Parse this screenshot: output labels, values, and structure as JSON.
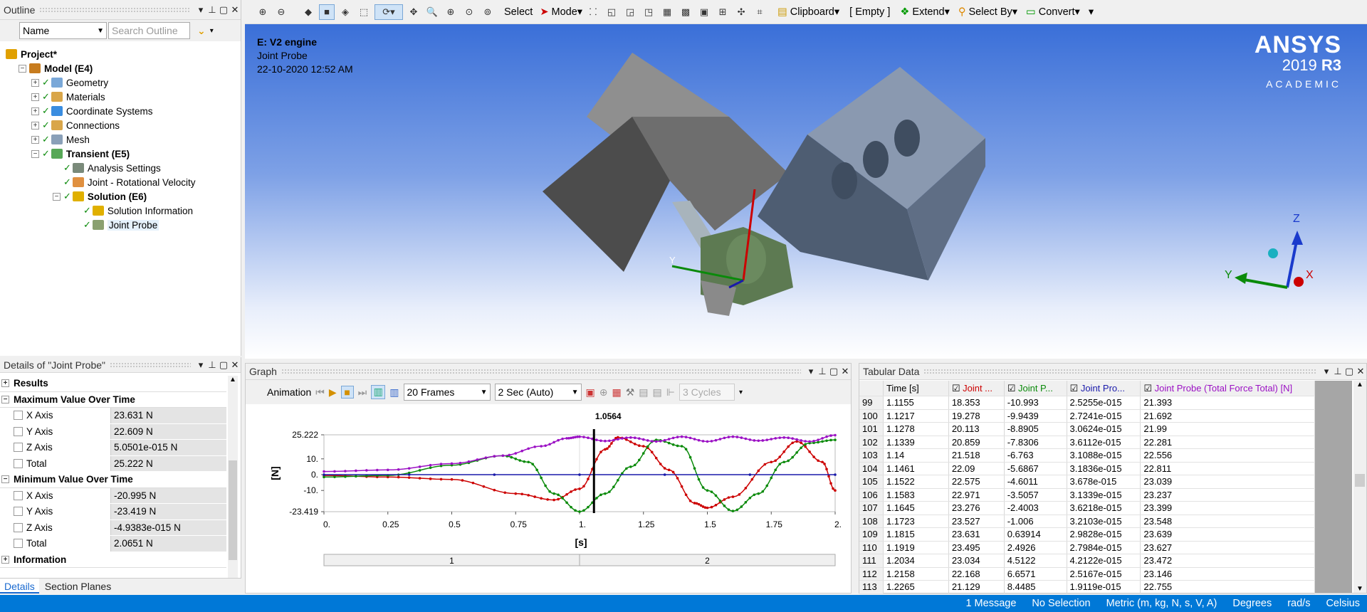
{
  "toolbar": {
    "select": "Select",
    "mode": "Mode",
    "clipboard": "Clipboard",
    "empty": "[ Empty ]",
    "extend": "Extend",
    "select_by": "Select By",
    "convert": "Convert"
  },
  "outline": {
    "title": "Outline",
    "filter_value": "Name",
    "search_placeholder": "Search Outline",
    "items": [
      {
        "label": "Project*",
        "level": 0,
        "bold": true,
        "icon": "project-icon"
      },
      {
        "label": "Model (E4)",
        "level": 1,
        "bold": true,
        "icon": "model-icon"
      },
      {
        "label": "Geometry",
        "level": 2,
        "bold": false,
        "icon": "geometry-icon"
      },
      {
        "label": "Materials",
        "level": 2,
        "bold": false,
        "icon": "materials-icon"
      },
      {
        "label": "Coordinate Systems",
        "level": 2,
        "bold": false,
        "icon": "coordinate-systems-icon"
      },
      {
        "label": "Connections",
        "level": 2,
        "bold": false,
        "icon": "connections-icon"
      },
      {
        "label": "Mesh",
        "level": 2,
        "bold": false,
        "icon": "mesh-icon"
      },
      {
        "label": "Transient (E5)",
        "level": 2,
        "bold": true,
        "icon": "transient-icon"
      },
      {
        "label": "Analysis Settings",
        "level": 3,
        "bold": false,
        "icon": "analysis-settings-icon"
      },
      {
        "label": "Joint - Rotational Velocity",
        "level": 3,
        "bold": false,
        "icon": "joint-load-icon"
      },
      {
        "label": "Solution (E6)",
        "level": 3,
        "bold": true,
        "icon": "solution-icon"
      },
      {
        "label": "Solution Information",
        "level": 4,
        "bold": false,
        "icon": "solution-information-icon"
      },
      {
        "label": "Joint Probe",
        "level": 4,
        "bold": false,
        "icon": "joint-probe-icon"
      }
    ]
  },
  "viewport": {
    "line1": "E: V2 engine",
    "line2": "Joint Probe",
    "line3": "22-10-2020 12:52 AM",
    "brand": "ANSYS",
    "version": "2019",
    "release": "R3",
    "edition": "ACADEMIC",
    "axis_z": "Z",
    "axis_y": "Y",
    "axis_x": "X"
  },
  "details": {
    "title": "Details of \"Joint Probe\"",
    "sections": [
      {
        "name": "Results",
        "expanded": false,
        "rows": []
      },
      {
        "name": "Maximum Value Over Time",
        "expanded": true,
        "rows": [
          {
            "label": "X Axis",
            "value": "23.631 N"
          },
          {
            "label": "Y Axis",
            "value": "22.609 N"
          },
          {
            "label": "Z Axis",
            "value": "5.0501e-015 N"
          },
          {
            "label": "Total",
            "value": "25.222 N"
          }
        ]
      },
      {
        "name": "Minimum Value Over Time",
        "expanded": true,
        "rows": [
          {
            "label": "X Axis",
            "value": "-20.995 N"
          },
          {
            "label": "Y Axis",
            "value": "-23.419 N"
          },
          {
            "label": "Z Axis",
            "value": "-4.9383e-015 N"
          },
          {
            "label": "Total",
            "value": "2.0651 N"
          }
        ]
      },
      {
        "name": "Information",
        "expanded": false,
        "rows": []
      }
    ]
  },
  "bottom_tabs": [
    "Details",
    "Section Planes"
  ],
  "graph": {
    "title": "Graph",
    "animation": "Animation",
    "frames": "20 Frames",
    "duration": "2 Sec (Auto)",
    "cycles": "3 Cycles",
    "marker": "1.0564",
    "ylabel": "[N]",
    "xlabel": "[s]",
    "steps": [
      "1",
      "2"
    ]
  },
  "chart_data": {
    "type": "line",
    "xlabel": "[s]",
    "ylabel": "[N]",
    "xlim": [
      0,
      2
    ],
    "ylim": [
      -23.419,
      25.222
    ],
    "x_ticks": [
      "0.",
      "0.25",
      "0.5",
      "0.75",
      "1.",
      "1.25",
      "1.5",
      "1.75",
      "2."
    ],
    "y_ticks": [
      "25.222",
      "10.",
      "0.",
      "-10.",
      "-23.419"
    ],
    "marker_x": 1.0564,
    "series": [
      {
        "color": "#cc0000",
        "x": [
          0,
          0.25,
          0.5,
          0.75,
          0.9,
          1.0,
          1.1,
          1.15,
          1.25,
          1.35,
          1.45,
          1.5,
          1.6,
          1.75,
          1.85,
          1.95,
          2.0
        ],
        "y": [
          -0.5,
          -1.5,
          -3,
          -12,
          -16,
          -9,
          16,
          23.6,
          18,
          3,
          -18,
          -21,
          -14,
          8,
          21,
          8,
          -10
        ]
      },
      {
        "color": "#0a8a0a",
        "x": [
          0,
          0.25,
          0.5,
          0.7,
          0.8,
          0.9,
          1.0,
          1.1,
          1.2,
          1.3,
          1.4,
          1.5,
          1.6,
          1.7,
          1.8,
          1.9,
          2.0
        ],
        "y": [
          -1.5,
          -0.5,
          6,
          12,
          8,
          -12,
          -23.4,
          -12,
          5,
          22,
          18,
          -10,
          -23,
          -12,
          8,
          20,
          22
        ]
      },
      {
        "color": "#1a1aaa",
        "x": [
          0,
          2.0
        ],
        "y": [
          0,
          0
        ]
      },
      {
        "color": "#9b10c4",
        "x": [
          0,
          0.25,
          0.5,
          0.7,
          0.85,
          0.95,
          1.0,
          1.1,
          1.2,
          1.3,
          1.4,
          1.5,
          1.6,
          1.7,
          1.8,
          1.9,
          2.0
        ],
        "y": [
          2,
          3,
          7,
          12,
          18,
          23,
          24,
          21.3,
          23.5,
          21,
          24,
          21,
          24,
          21.5,
          23.5,
          21,
          25
        ]
      }
    ]
  },
  "tabular": {
    "title": "Tabular Data",
    "headers": [
      "Time [s]",
      "Joint ...",
      "Joint P...",
      "Joint Pro...",
      "Joint Probe (Total Force Total) [N]"
    ],
    "header_colors": [
      "#000000",
      "#cc0000",
      "#0a8a0a",
      "#1a1aaa",
      "#9b10c4"
    ],
    "rows": [
      [
        "99",
        "1.1155",
        "18.353",
        "-10.993",
        "2.5255e-015",
        "21.393"
      ],
      [
        "100",
        "1.1217",
        "19.278",
        "-9.9439",
        "2.7241e-015",
        "21.692"
      ],
      [
        "101",
        "1.1278",
        "20.113",
        "-8.8905",
        "3.0624e-015",
        "21.99"
      ],
      [
        "102",
        "1.1339",
        "20.859",
        "-7.8306",
        "3.6112e-015",
        "22.281"
      ],
      [
        "103",
        "1.14",
        "21.518",
        "-6.763",
        "3.1088e-015",
        "22.556"
      ],
      [
        "104",
        "1.1461",
        "22.09",
        "-5.6867",
        "3.1836e-015",
        "22.811"
      ],
      [
        "105",
        "1.1522",
        "22.575",
        "-4.6011",
        "3.678e-015",
        "23.039"
      ],
      [
        "106",
        "1.1583",
        "22.971",
        "-3.5057",
        "3.1339e-015",
        "23.237"
      ],
      [
        "107",
        "1.1645",
        "23.276",
        "-2.4003",
        "3.6218e-015",
        "23.399"
      ],
      [
        "108",
        "1.1723",
        "23.527",
        "-1.006",
        "3.2103e-015",
        "23.548"
      ],
      [
        "109",
        "1.1815",
        "23.631",
        "0.63914",
        "2.9828e-015",
        "23.639"
      ],
      [
        "110",
        "1.1919",
        "23.495",
        "2.4926",
        "2.7984e-015",
        "23.627"
      ],
      [
        "111",
        "1.2034",
        "23.034",
        "4.5122",
        "4.2122e-015",
        "23.472"
      ],
      [
        "112",
        "1.2158",
        "22.168",
        "6.6571",
        "2.5167e-015",
        "23.146"
      ],
      [
        "113",
        "1.2265",
        "21.129",
        "8.4485",
        "1.9119e-015",
        "22.755"
      ]
    ]
  },
  "status": {
    "messages": "1 Message",
    "selection": "No Selection",
    "units": "Metric (m, kg, N, s, V, A)",
    "angle": "Degrees",
    "rot": "rad/s",
    "temp": "Celsius"
  },
  "colors": {
    "status_bar": "#0078d7",
    "viewport_top": "#3a6fd8",
    "viewport_bottom": "#ffffff"
  }
}
